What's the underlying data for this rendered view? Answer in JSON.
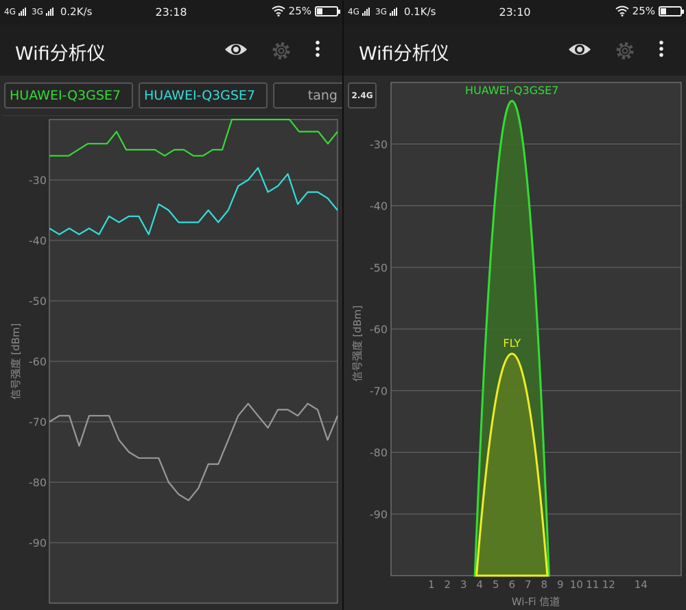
{
  "left_screen": {
    "status": {
      "net1": "4G",
      "net2": "3G",
      "speed": "0.2K/s",
      "time": "23:18",
      "battery": "25%",
      "battery_level": 0.25
    },
    "app_title": "Wifi分析仪",
    "tabs": [
      {
        "label": "HUAWEI-Q3GSE7",
        "color": "#33dd33"
      },
      {
        "label": "HUAWEI-Q3GSE7",
        "color": "#33dddd"
      },
      {
        "label": "tang",
        "color": "#aaaaaa"
      }
    ],
    "chart_data": {
      "type": "line",
      "ylabel": "信号强度 [dBm]",
      "ylim": [
        -100,
        -20
      ],
      "yticks": [
        -30,
        -40,
        -50,
        -60,
        -70,
        -80,
        -90
      ],
      "series": [
        {
          "name": "HUAWEI-Q3GSE7",
          "color": "#33dd33",
          "values": [
            -26,
            -26,
            -26,
            -25,
            -24,
            -24,
            -24,
            -22,
            -25,
            -25,
            -25,
            -25,
            -26,
            -25,
            -25,
            -26,
            -26,
            -25,
            -25,
            -20,
            -20,
            -20,
            -20,
            -20,
            -20,
            -20,
            -22,
            -22,
            -22,
            -24,
            -22
          ]
        },
        {
          "name": "HUAWEI-Q3GSE7",
          "color": "#33dddd",
          "values": [
            -38,
            -39,
            -38,
            -39,
            -38,
            -39,
            -36,
            -37,
            -36,
            -36,
            -39,
            -34,
            -35,
            -37,
            -37,
            -37,
            -35,
            -37,
            -35,
            -31,
            -30,
            -28,
            -32,
            -31,
            -29,
            -34,
            -32,
            -32,
            -33,
            -35
          ]
        },
        {
          "name": "tang",
          "color": "#999999",
          "values": [
            -70,
            -69,
            -69,
            -74,
            -69,
            -69,
            -69,
            -73,
            -75,
            -76,
            -76,
            -76,
            -80,
            -82,
            -83,
            -81,
            -77,
            -77,
            -73,
            -69,
            -67,
            -69,
            -71,
            -68,
            -68,
            -69,
            -67,
            -68,
            -73,
            -69
          ]
        }
      ]
    }
  },
  "right_screen": {
    "status": {
      "net1": "4G",
      "net2": "3G",
      "speed": "0.1K/s",
      "time": "23:10",
      "battery": "25%",
      "battery_level": 0.25
    },
    "app_title": "Wifi分析仪",
    "band_button": "2.4G",
    "chart_data": {
      "type": "area",
      "xlabel": "Wi-Fi 信道",
      "ylabel": "信号强度 [dBm]",
      "ylim": [
        -100,
        -20
      ],
      "yticks": [
        -30,
        -40,
        -50,
        -60,
        -70,
        -80,
        -90
      ],
      "xlim": [
        -1.5,
        16.5
      ],
      "xticks": [
        1,
        2,
        3,
        4,
        5,
        6,
        7,
        8,
        9,
        10,
        11,
        12,
        14
      ],
      "networks": [
        {
          "name": "HUAWEI-Q3GSE7",
          "channel": 6,
          "level": -23,
          "span": [
            3.7,
            8.3
          ],
          "color": "#33dd33",
          "fill": "#3b6a28"
        },
        {
          "name": "FLY",
          "channel": 6,
          "level": -64,
          "span": [
            3.8,
            8.2
          ],
          "color": "#eeee22",
          "fill": "#5b7a22"
        }
      ]
    }
  }
}
